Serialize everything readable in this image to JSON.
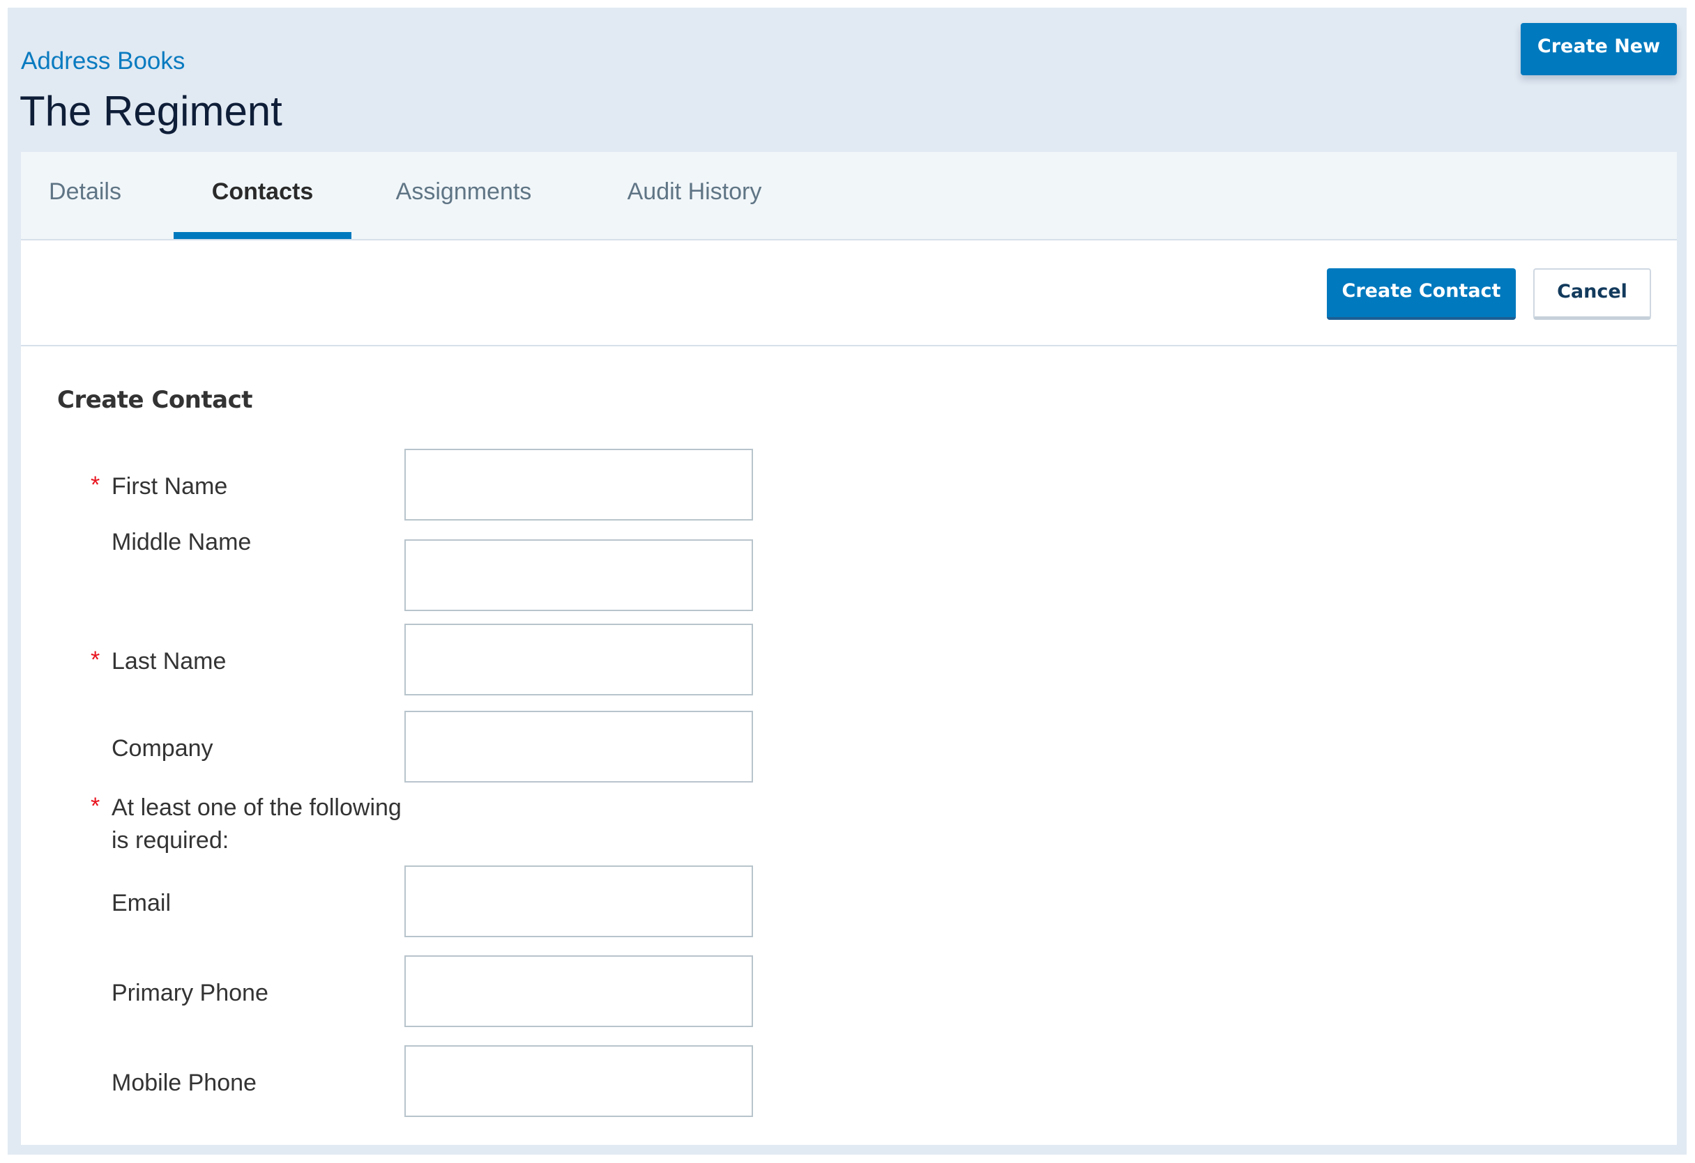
{
  "header": {
    "breadcrumb": "Address Books",
    "title": "The Regiment",
    "create_new_label": "Create New"
  },
  "tabs": [
    {
      "label": "Details",
      "active": false
    },
    {
      "label": "Contacts",
      "active": true
    },
    {
      "label": "Assignments",
      "active": false
    },
    {
      "label": "Audit History",
      "active": false
    }
  ],
  "actions": {
    "create_contact_label": "Create Contact",
    "cancel_label": "Cancel"
  },
  "form": {
    "heading": "Create Contact",
    "required_marker": "*",
    "fields": {
      "first_name": {
        "label": "First Name",
        "required": true,
        "value": "",
        "placeholder": ""
      },
      "middle_name": {
        "label": "Middle Name",
        "required": false,
        "value": "",
        "placeholder": ""
      },
      "last_name": {
        "label": "Last Name",
        "required": true,
        "value": "",
        "placeholder": ""
      },
      "company": {
        "label": "Company",
        "required": false,
        "value": "",
        "placeholder": ""
      },
      "email": {
        "label": "Email",
        "required": false,
        "value": "",
        "placeholder": ""
      },
      "primary_phone": {
        "label": "Primary Phone",
        "required": false,
        "value": "",
        "placeholder": ""
      },
      "mobile_phone": {
        "label": "Mobile Phone",
        "required": false,
        "value": "",
        "placeholder": ""
      }
    },
    "group_note": "At least one of the following is required:"
  },
  "colors": {
    "accent": "#0079be",
    "link": "#0a7bc0",
    "required": "#e8131e",
    "page_background": "#e1e9f2",
    "tabbar_background": "#f1f6f9"
  }
}
